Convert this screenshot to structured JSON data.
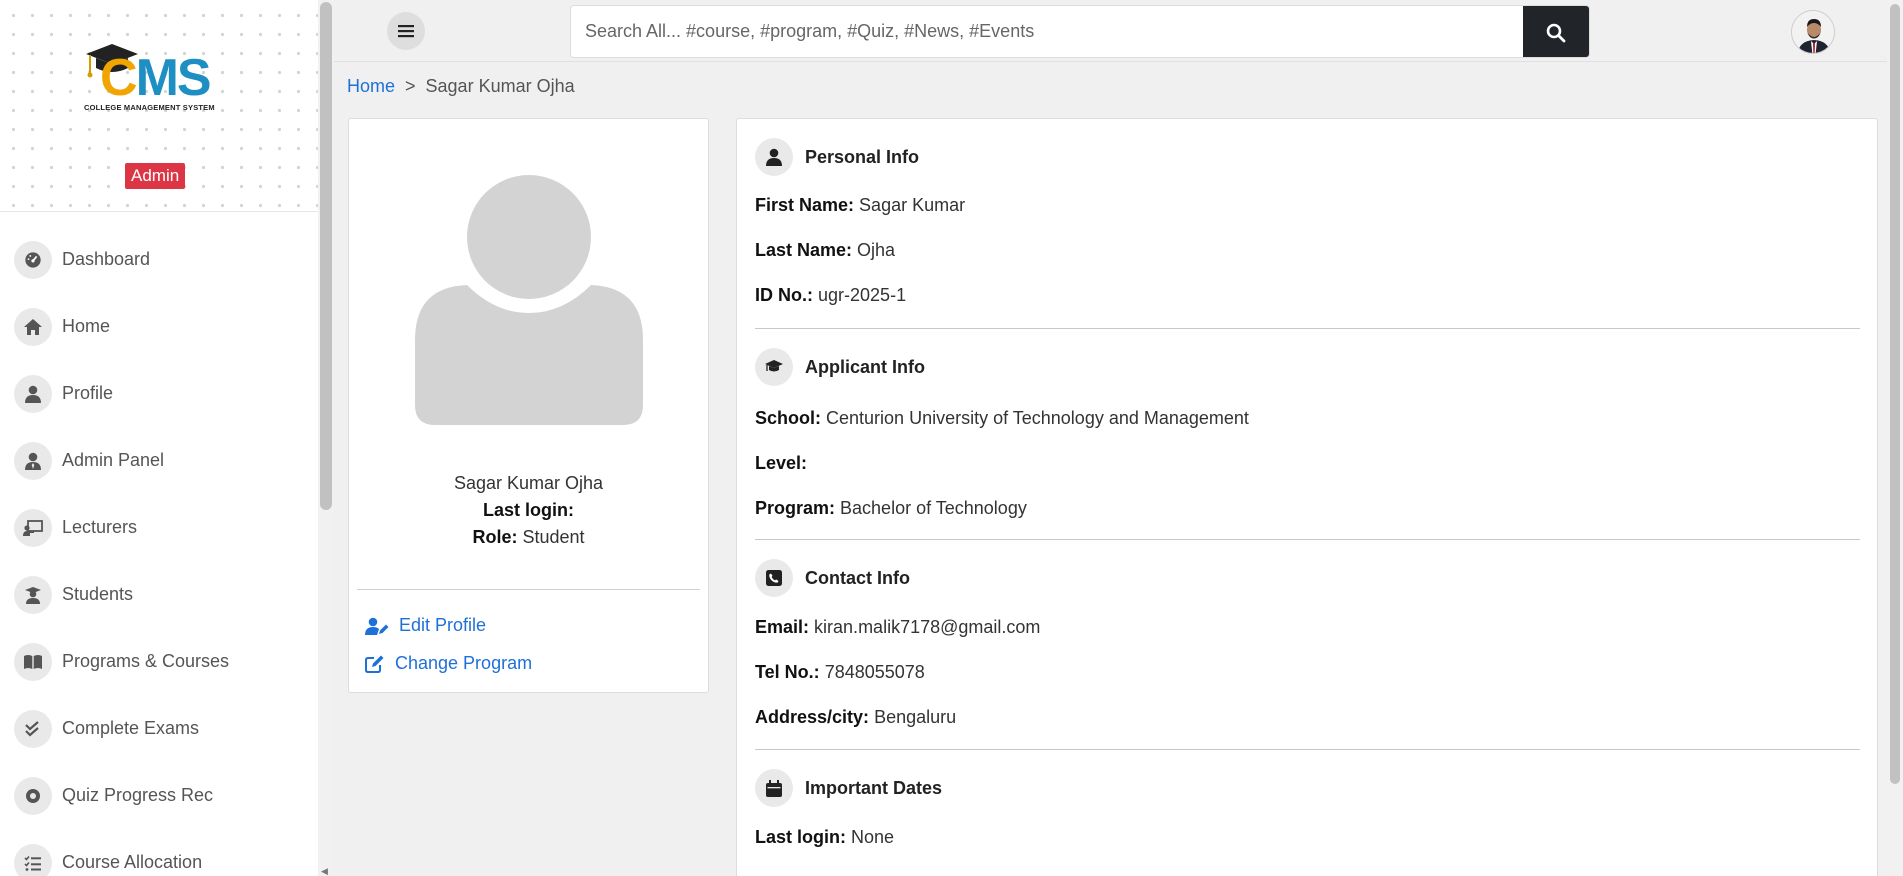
{
  "sidebar": {
    "logo": {
      "text_c": "C",
      "text_ms": "MS",
      "subtitle": "COLLEGE MANAGEMENT SYSTEM"
    },
    "role_badge": "Admin",
    "items": [
      {
        "label": "Dashboard",
        "icon": "gauge-icon"
      },
      {
        "label": "Home",
        "icon": "home-icon"
      },
      {
        "label": "Profile",
        "icon": "user-icon"
      },
      {
        "label": "Admin Panel",
        "icon": "user-tie-icon"
      },
      {
        "label": "Lecturers",
        "icon": "chalkboard-teacher-icon"
      },
      {
        "label": "Students",
        "icon": "graduate-icon"
      },
      {
        "label": "Programs & Courses",
        "icon": "book-open-icon"
      },
      {
        "label": "Complete Exams",
        "icon": "check-double-icon"
      },
      {
        "label": "Quiz Progress Rec",
        "icon": "record-icon"
      },
      {
        "label": "Course Allocation",
        "icon": "list-check-icon"
      }
    ]
  },
  "topbar": {
    "search_placeholder": "Search All... #course, #program, #Quiz, #News, #Events"
  },
  "breadcrumb": {
    "home": "Home",
    "separator": ">",
    "current": "Sagar Kumar Ojha"
  },
  "profile_card": {
    "name": "Sagar Kumar Ojha",
    "last_login_label": "Last login:",
    "last_login_value": "",
    "role_label": "Role:",
    "role_value": "Student",
    "edit_profile": "Edit Profile",
    "change_program": "Change Program"
  },
  "personal_info": {
    "title": "Personal Info",
    "first_name_label": "First Name:",
    "first_name": "Sagar Kumar",
    "last_name_label": "Last Name:",
    "last_name": "Ojha",
    "id_label": "ID No.:",
    "id": "ugr-2025-1"
  },
  "applicant_info": {
    "title": "Applicant Info",
    "school_label": "School:",
    "school": "Centurion University of Technology and Management",
    "level_label": "Level:",
    "level": "",
    "program_label": "Program:",
    "program": "Bachelor of Technology"
  },
  "contact_info": {
    "title": "Contact Info",
    "email_label": "Email:",
    "email": "kiran.malik7178@gmail.com",
    "tel_label": "Tel No.:",
    "tel": "7848055078",
    "address_label": "Address/city:",
    "address": "Bengaluru"
  },
  "important_dates": {
    "title": "Important Dates",
    "last_login_label": "Last login:",
    "last_login": "None"
  },
  "colors": {
    "accent": "#1e70d8",
    "badge": "#dc3545",
    "search_btn": "#212529",
    "logo_c": "#f0a500",
    "logo_ms": "#1e8fc2"
  }
}
